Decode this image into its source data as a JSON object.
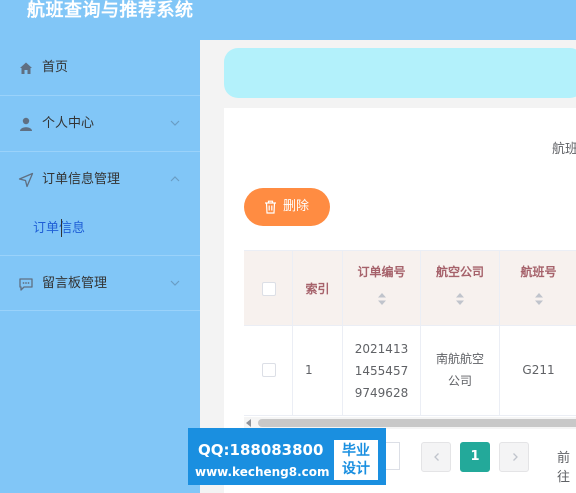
{
  "app": {
    "title": "航班查询与推荐系统"
  },
  "sidebar": {
    "items": [
      {
        "label": "首页",
        "icon": "home-icon"
      },
      {
        "label": "个人中心",
        "icon": "user-icon"
      },
      {
        "label": "订单信息管理",
        "icon": "navigation-icon"
      },
      {
        "label": "留言板管理",
        "icon": "message-icon"
      }
    ],
    "submenu": {
      "label": "订单信息"
    }
  },
  "search": {
    "label": "航班"
  },
  "toolbar": {
    "delete_label": "删除"
  },
  "table": {
    "headers": [
      "索引",
      "订单编号",
      "航空公司",
      "航班号"
    ],
    "rows": [
      {
        "index": "1",
        "order_no": [
          "2021413",
          "1455457",
          "9749628"
        ],
        "airline": [
          "南航航空",
          "公司"
        ],
        "flight_no": "G211"
      }
    ]
  },
  "pagination": {
    "current_page": "1",
    "goto_label": "前往"
  },
  "watermark": {
    "qq": "QQ:188083800",
    "site": "www.kecheng8.com",
    "badge_line1": "毕业",
    "badge_line2": "设计"
  },
  "colors": {
    "sidebar": "#81c6f7",
    "accent_orange": "#ff8c42",
    "page_active": "#23a99a",
    "breadcrumb": "#b3f1fb"
  }
}
